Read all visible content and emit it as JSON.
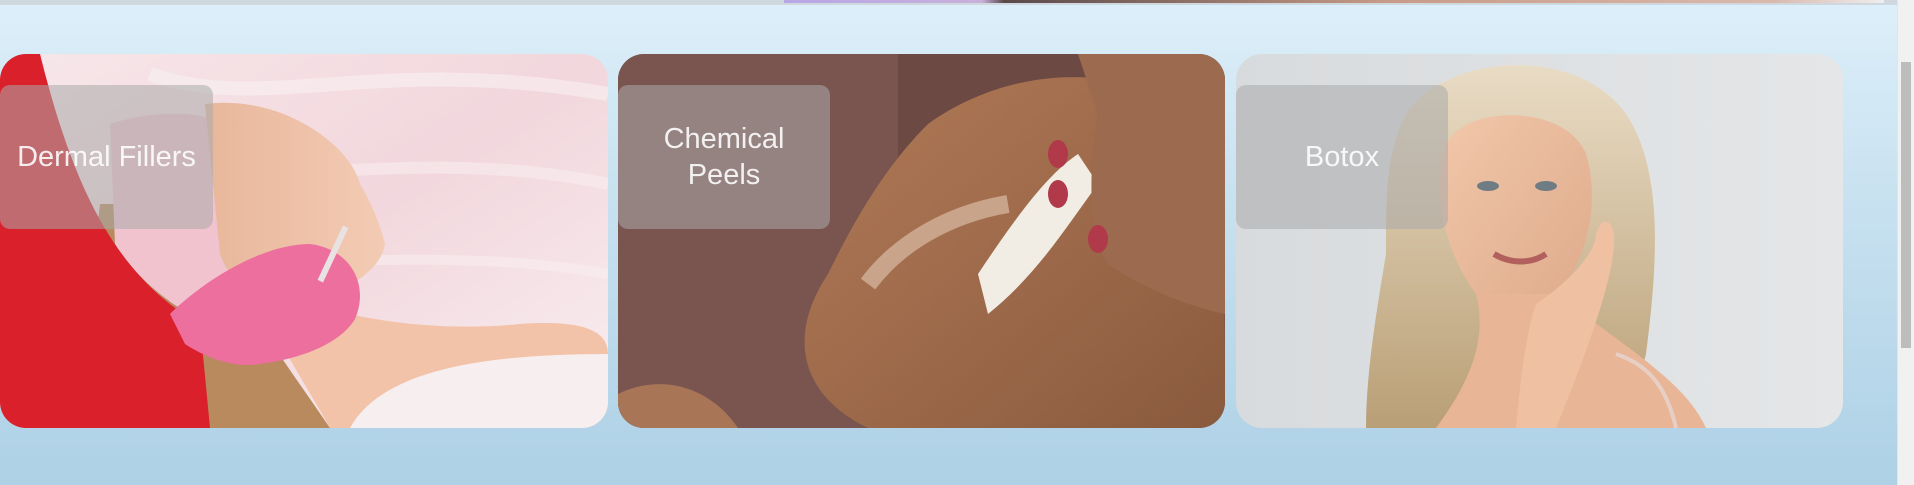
{
  "cards": [
    {
      "label": "Dermal Fillers",
      "image": "dermal-fillers-photo"
    },
    {
      "label": "Chemical Peels",
      "image": "chemical-peels-photo"
    },
    {
      "label": "Botox",
      "image": "botox-photo"
    }
  ],
  "colors": {
    "background_top": "#ddeffa",
    "background_bottom": "#aed1e6",
    "label_overlay": "rgba(170,170,170,0.55)"
  }
}
